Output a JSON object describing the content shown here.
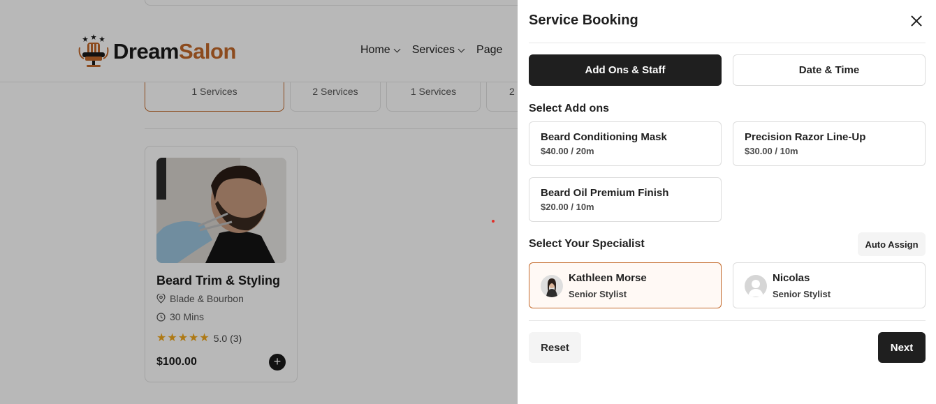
{
  "background": {
    "logo": {
      "word1": "Dream",
      "word2": "Salon",
      "icon": "barber-chair-logo-icon"
    },
    "nav": [
      {
        "label": "Home"
      },
      {
        "label": "Services"
      },
      {
        "label": "Page"
      }
    ],
    "category_tabs": [
      {
        "count": "1 Services",
        "active": true
      },
      {
        "count": "2 Services",
        "active": false
      },
      {
        "count": "1 Services",
        "active": false
      },
      {
        "count": "2",
        "active": false
      }
    ],
    "service_card": {
      "title": "Beard Trim & Styling",
      "location": "Blade & Bourbon",
      "duration": "30 Mins",
      "rating": "5.0 (3)",
      "stars": 5,
      "price": "$100.00",
      "add_icon": "+"
    }
  },
  "drawer": {
    "title": "Service Booking",
    "close_icon": "close-icon",
    "tabs": [
      {
        "label": "Add Ons & Staff",
        "active": true
      },
      {
        "label": "Date & Time",
        "active": false
      }
    ],
    "addons_label": "Select Add ons",
    "addons": [
      {
        "name": "Beard Conditioning Mask",
        "price": "$40.00 / 20m"
      },
      {
        "name": "Precision Razor Line-Up",
        "price": "$30.00 / 10m"
      },
      {
        "name": "Beard Oil Premium Finish",
        "price": "$20.00 / 10m"
      }
    ],
    "specialist_label": "Select Your Specialist",
    "auto_assign_label": "Auto Assign",
    "specialists": [
      {
        "name": "Kathleen Morse",
        "role": "Senior Stylist",
        "selected": true
      },
      {
        "name": "Nicolas",
        "role": "Senior Stylist",
        "selected": false
      }
    ],
    "reset_label": "Reset",
    "next_label": "Next"
  },
  "colors": {
    "accent": "#c3692a",
    "dark": "#1f1f1f",
    "star": "#f2a81c"
  }
}
